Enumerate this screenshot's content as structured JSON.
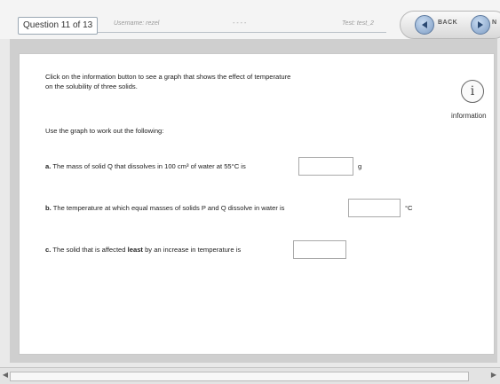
{
  "header": {
    "question_counter": "Question 11 of 13",
    "username": "Username: rezel",
    "dots": "- - - -",
    "test": "Test: test_2",
    "back_label": "BACK",
    "next_label": "N"
  },
  "intro": {
    "line1": "Click on the information button to see a graph that shows the effect of temperature",
    "line2": "on the solubility of three solids."
  },
  "instruction": "Use the graph to work out the following:",
  "questions": [
    {
      "letter": "a.",
      "text": "The mass of solid Q that dissolves in 100 cm³ of water at 55°C is",
      "answer": "",
      "unit": "g"
    },
    {
      "letter": "b.",
      "text": "The temperature at which equal masses of solids P and Q dissolve in water is",
      "answer": "",
      "unit": "°C"
    },
    {
      "letter": "c.",
      "text_before": "The solid that is affected",
      "text_bold": "least",
      "text_after": "by an increase in temperature is",
      "answer": ""
    }
  ],
  "info": {
    "icon_glyph": "i",
    "label": "information"
  }
}
